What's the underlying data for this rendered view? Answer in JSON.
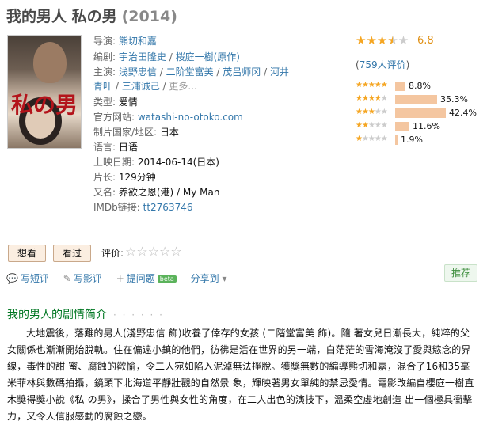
{
  "movie": {
    "title": "我的男人 私の男",
    "year": "(2014)"
  },
  "info": {
    "director_key": "导演:",
    "director": "熊切和嘉",
    "writer_key": "编剧:",
    "writers": [
      "宇治田隆史",
      "桜庭一樹(原作)"
    ],
    "cast_key": "主演:",
    "cast_line1": [
      "浅野忠信",
      "二阶堂富美",
      "茂吕师冈",
      "河井"
    ],
    "cast_line2": [
      "青叶",
      "三浦诚己"
    ],
    "more": "更多...",
    "genre_key": "类型:",
    "genre": "爱情",
    "site_key": "官方网站:",
    "site": "watashi-no-otoko.com",
    "country_key": "制片国家/地区:",
    "country": "日本",
    "lang_key": "语言:",
    "lang": "日语",
    "release_key": "上映日期:",
    "release": "2014-06-14(日本)",
    "runtime_key": "片长:",
    "runtime": "129分钟",
    "aka_key": "又名:",
    "aka": "养欲之恩(港) / My Man",
    "imdb_key": "IMDb链接:",
    "imdb": "tt2763746"
  },
  "rating": {
    "score": "6.8",
    "stars": 3.5,
    "votes_text": "759人评价",
    "hist": [
      {
        "stars": 5,
        "percent": 8.8,
        "label": "8.8%"
      },
      {
        "stars": 4,
        "percent": 35.3,
        "label": "35.3%"
      },
      {
        "stars": 3,
        "percent": 42.4,
        "label": "42.4%"
      },
      {
        "stars": 2,
        "percent": 11.6,
        "label": "11.6%"
      },
      {
        "stars": 1,
        "percent": 1.9,
        "label": "1.9%"
      }
    ]
  },
  "buttons": {
    "want": "想看",
    "watched": "看过",
    "rate_label": "评价:"
  },
  "actions": {
    "short_review": "写短评",
    "review": "写影评",
    "question": "提问题",
    "beta": "beta",
    "share": "分享到",
    "recommend": "推荐"
  },
  "synopsis": {
    "title": "我的男人的剧情简介",
    "dots": "· · · · · ·",
    "text": "大地震後，落難的男人(淺野忠信 飾)收養了倖存的女孩 (二階堂富美 飾)。隨 著女兒日漸長大，純粹的父女關係也漸漸開始脫軌。住在偏遠小鎮的他們，彷彿是活在世界的另一端，白茫茫的雪海淹沒了愛與慾念的界線，毒性的甜 蜜、腐蝕的歡愉，令二人宛如陷入泥淖無法掙脫。獲獎無數的編導熊切和嘉，混合了16和35毫米菲林與數碼拍攝，鏡頭下北海道平靜壯觀的自然景 象，輝映著男女單純的禁忌愛情。電影改編自櫻庭一樹直木獎得獎小說《私 の男》，揉合了男性與女性的角度，在二人出色的演技下，溫柔空虛地創造 出一個極具衝擊力，又令人信服感動的腐蝕之戀。"
  }
}
